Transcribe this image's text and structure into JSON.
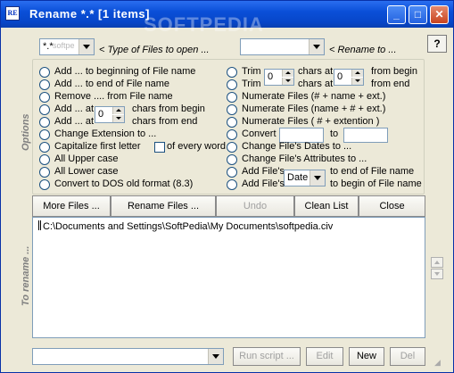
{
  "window": {
    "title": "Rename  *.*   [1 items]",
    "watermark": "SOFTPEDIA",
    "icon": "app-icon",
    "icon_text": "RE",
    "controls": {
      "minimize": "_",
      "maximize": "□",
      "close": "✕"
    }
  },
  "top": {
    "type_combo_value": "*.*",
    "type_combo_ghost": "softpe",
    "type_label": "< Type of Files to open ...",
    "rename_combo_value": "",
    "rename_label": "< Rename to ...",
    "help": "?"
  },
  "options_label": "Options",
  "left_options": [
    {
      "label": "Add ... to beginning of File name"
    },
    {
      "label": "Add ... to end of File name"
    },
    {
      "label": "Remove .... from File name"
    },
    {
      "label": "Add ... at",
      "suffix": "chars from begin",
      "spin": "0"
    },
    {
      "label": "Add ... at",
      "suffix": "chars from  end"
    },
    {
      "label": "Change Extension to ..."
    },
    {
      "label": "Capitalize first letter",
      "checkbox_label": "of every word"
    },
    {
      "label": "All Upper case"
    },
    {
      "label": "All Lower case"
    },
    {
      "label": "Convert to DOS old format  (8.3)"
    }
  ],
  "right_options": [
    {
      "label": "Trim",
      "spin": "0",
      "suffix1": "chars at",
      "suffix2": "from begin"
    },
    {
      "label": "Trim",
      "suffix1": "chars at",
      "spin": "0",
      "suffix2": "from  end"
    },
    {
      "label": "Numerate Files (# + name + ext.)"
    },
    {
      "label": "Numerate Files (name + # + ext.)"
    },
    {
      "label": "Numerate Files ( # + extention )"
    },
    {
      "label": "Convert",
      "mid": "to"
    },
    {
      "label": "Change File's Dates to ..."
    },
    {
      "label": "Change File's Attributes to ..."
    },
    {
      "label": "Add File's",
      "select": "Date",
      "suffix": "to end of File name"
    },
    {
      "label": "Add File's",
      "suffix": "to begin of File name"
    }
  ],
  "buttons": {
    "more_files": "More Files ...",
    "rename_files": "Rename Files ...",
    "undo": "Undo",
    "clean_list": "Clean List",
    "close": "Close"
  },
  "rename_label": "To rename ...",
  "files": [
    "C:\\Documents and Settings\\SoftPedia\\My Documents\\softpedia.civ"
  ],
  "bottom": {
    "script_combo_value": "",
    "run_script": "Run script ...",
    "edit": "Edit",
    "new": "New",
    "del": "Del"
  }
}
